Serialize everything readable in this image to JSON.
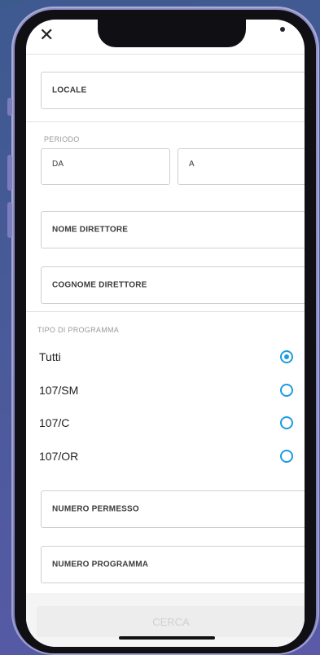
{
  "header": {
    "close_icon": "close-icon",
    "close_glyph": "✕"
  },
  "form": {
    "locale_label": "LOCALE",
    "periodo_label": "PERIODO",
    "da_label": "DA",
    "a_label": "A",
    "nome_direttore_label": "NOME DIRETTORE",
    "cognome_direttore_label": "COGNOME DIRETTORE",
    "tipo_programma_label": "TIPO DI PROGRAMMA",
    "program_options": [
      {
        "label": "Tutti",
        "selected": true
      },
      {
        "label": "107/SM",
        "selected": false
      },
      {
        "label": "107/C",
        "selected": false
      },
      {
        "label": "107/OR",
        "selected": false
      }
    ],
    "numero_permesso_label": "NUMERO PERMESSO",
    "numero_programma_label": "NUMERO PROGRAMMA",
    "search_button_label": "CERCA"
  },
  "colors": {
    "accent": "#1e9be0",
    "frame": "#8f8fc8",
    "background": "#4a5a9a"
  }
}
